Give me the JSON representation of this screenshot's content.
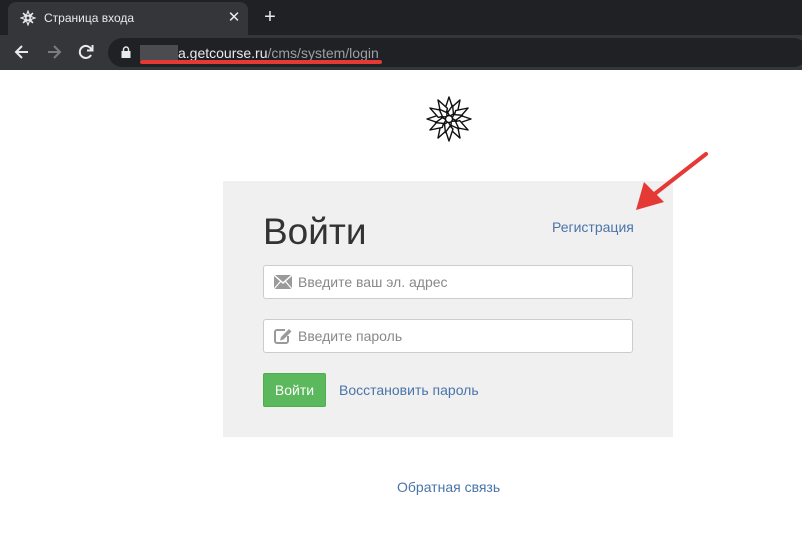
{
  "browser": {
    "tab_title": "Страница входа",
    "tab_close": "✕",
    "new_tab": "+",
    "url_host": "a.getcourse.ru",
    "url_path": "/cms/system/login"
  },
  "login": {
    "heading": "Войти",
    "register_link": "Регистрация",
    "email_placeholder": "Введите ваш эл. адрес",
    "password_placeholder": "Введите пароль",
    "submit_label": "Войти",
    "restore_link": "Восстановить пароль"
  },
  "footer": {
    "feedback_link": "Обратная связь"
  },
  "colors": {
    "accent_green": "#5cb85c",
    "link_blue": "#4a74a8",
    "annotation_red": "#e53935"
  },
  "icons": [
    "flower-logo-icon",
    "envelope-icon",
    "edit-icon",
    "lock-icon",
    "back-arrow-icon",
    "forward-arrow-icon",
    "reload-icon"
  ]
}
